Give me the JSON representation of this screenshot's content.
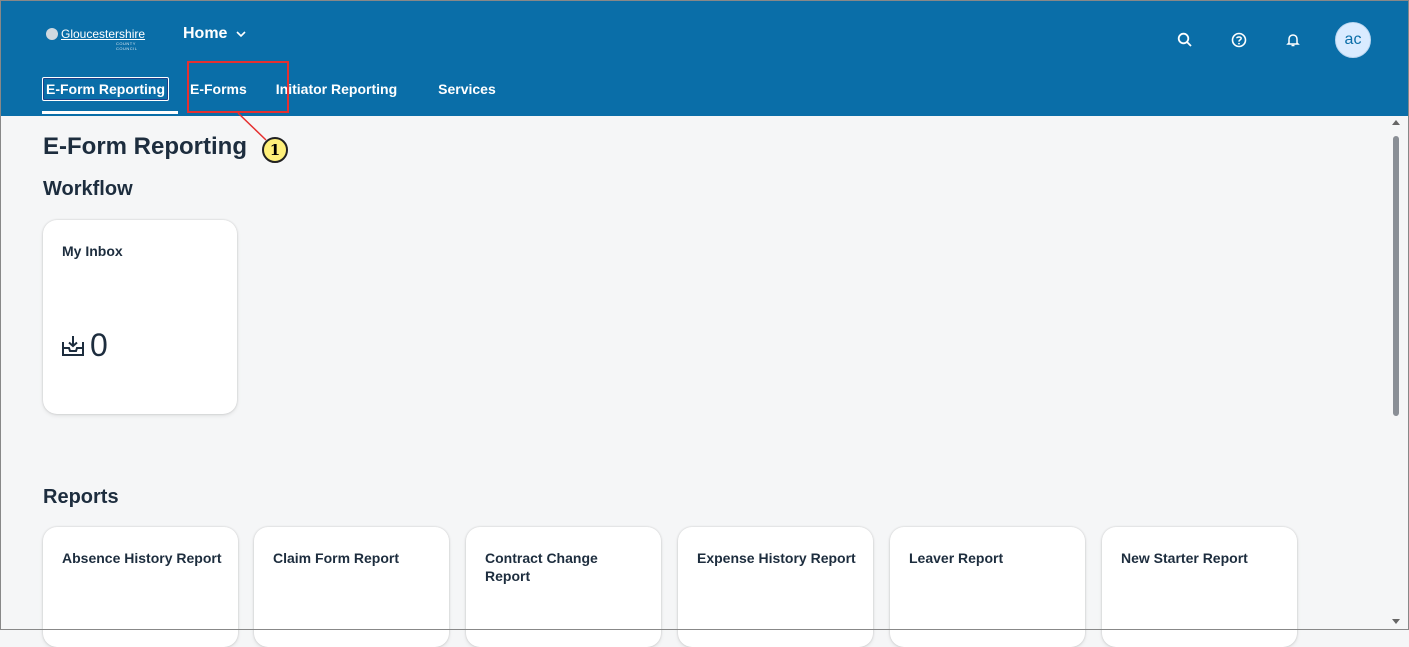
{
  "header": {
    "logo_text": "Gloucestershire",
    "logo_subtext": "COUNTY COUNCIL",
    "home_label": "Home",
    "avatar_initials": "ac"
  },
  "icons": {
    "search": "search-icon",
    "help": "help-icon",
    "notifications": "bell-icon",
    "home_dropdown": "chevron-down-icon",
    "inbox": "inbox-download-icon"
  },
  "tabs": [
    {
      "label": "E-Form Reporting",
      "active": true
    },
    {
      "label": "E-Forms",
      "active": false
    },
    {
      "label": "Initiator Reporting",
      "active": false
    },
    {
      "label": "Services",
      "active": false
    }
  ],
  "page": {
    "title": "E-Form Reporting",
    "workflow_title": "Workflow",
    "reports_title": "Reports"
  },
  "workflow_tiles": [
    {
      "title": "My Inbox",
      "count": "0"
    }
  ],
  "report_tiles": [
    {
      "title": "Absence History Report"
    },
    {
      "title": "Claim Form Report"
    },
    {
      "title": "Contract Change Report"
    },
    {
      "title": "Expense History Report"
    },
    {
      "title": "Leaver Report"
    },
    {
      "title": "New Starter Report"
    }
  ],
  "annotation": {
    "badge_number": "1",
    "color": "#e53030"
  },
  "colors": {
    "shell": "#0a6ea8",
    "background": "#f5f6f7",
    "text": "#1d2d3e"
  }
}
